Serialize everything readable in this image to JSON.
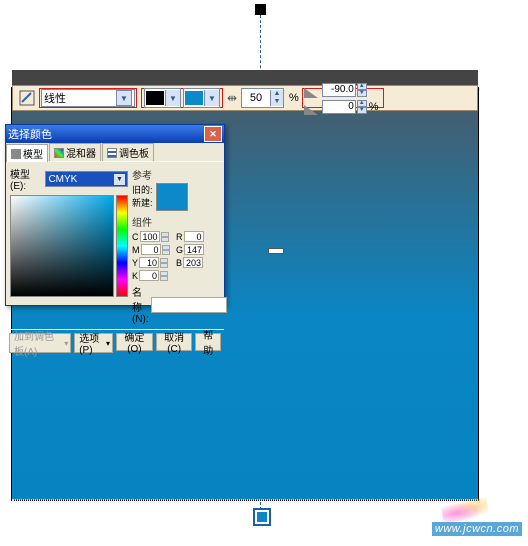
{
  "toolbar": {
    "type": "线性",
    "midpoint": "50",
    "pct": "%",
    "angle": "-90.0",
    "edgepad": "0",
    "start_color": "#000000",
    "end_color": "#0b89c8"
  },
  "dialog": {
    "title": "选择颜色",
    "tabs": [
      "模型",
      "混和器",
      "调色板"
    ],
    "model_label": "模型(E):",
    "model": "CMYK",
    "ref_label": "参考",
    "old_label": "旧的:",
    "new_label": "新建:",
    "comp_label": "组件",
    "comps": [
      {
        "k": "C",
        "v": "100"
      },
      {
        "k": "M",
        "v": "0"
      },
      {
        "k": "Y",
        "v": "10"
      },
      {
        "k": "K",
        "v": "0"
      },
      {
        "k": "R",
        "v": "0"
      },
      {
        "k": "G",
        "v": "147"
      },
      {
        "k": "B",
        "v": "203"
      }
    ],
    "name_label": "名称(N):",
    "name_value": "",
    "buttons": [
      "加到调色板(A)",
      "选项(P)",
      "确定(O)",
      "取消(C)",
      "帮助"
    ]
  },
  "watermark": "www.jcwcn.com"
}
